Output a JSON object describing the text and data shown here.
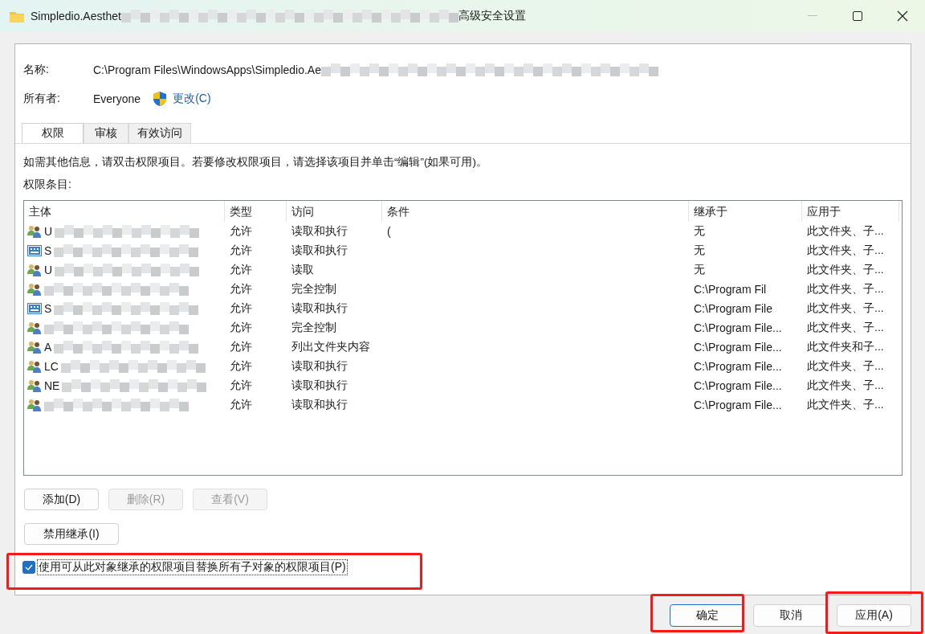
{
  "window": {
    "title_start": "Simpledio.Aesthet",
    "title_end": "高级安全设置"
  },
  "name": {
    "label": "名称:",
    "value": "C:\\Program Files\\WindowsApps\\Simpledio.Ae"
  },
  "owner": {
    "label": "所有者:",
    "value": "Everyone",
    "change_link": "更改(C)"
  },
  "tabs": [
    {
      "label": "权限",
      "selected": true
    },
    {
      "label": "审核",
      "selected": false
    },
    {
      "label": "有效访问",
      "selected": false
    }
  ],
  "info": "如需其他信息，请双击权限项目。若要修改权限项目，请选择该项目并单击“编辑”(如果可用)。",
  "entries_label": "权限条目:",
  "table": {
    "columns": [
      "主体",
      "类型",
      "访问",
      "条件",
      "继承于",
      "应用于"
    ],
    "rows": [
      {
        "kind": "group",
        "principal": "U",
        "redacted": true,
        "type": "允许",
        "access": "读取和执行",
        "condition": "(",
        "inherited_from": "无",
        "applies_to": "此文件夹、子..."
      },
      {
        "kind": "sid",
        "principal": "S",
        "redacted": true,
        "type": "允许",
        "access": "读取和执行",
        "condition": "",
        "inherited_from": "无",
        "applies_to": "此文件夹、子..."
      },
      {
        "kind": "group",
        "principal": "U",
        "redacted": true,
        "type": "允许",
        "access": "读取",
        "condition": "",
        "inherited_from": "无",
        "applies_to": "此文件夹、子..."
      },
      {
        "kind": "group",
        "principal": "",
        "redacted": true,
        "type": "允许",
        "access": "完全控制",
        "condition": "",
        "inherited_from": "C:\\Program Fil",
        "applies_to": "此文件夹、子..."
      },
      {
        "kind": "sid",
        "principal": "S",
        "redacted": true,
        "type": "允许",
        "access": "读取和执行",
        "condition": "",
        "inherited_from": "C:\\Program File",
        "applies_to": "此文件夹、子..."
      },
      {
        "kind": "group",
        "principal": "",
        "redacted": true,
        "type": "允许",
        "access": "完全控制",
        "condition": "",
        "inherited_from": "C:\\Program File...",
        "applies_to": "此文件夹、子..."
      },
      {
        "kind": "group",
        "principal": "A",
        "redacted": true,
        "type": "允许",
        "access": "列出文件夹内容",
        "condition": "",
        "inherited_from": "C:\\Program File...",
        "applies_to": "此文件夹和子..."
      },
      {
        "kind": "group",
        "principal": "LC",
        "redacted": true,
        "type": "允许",
        "access": "读取和执行",
        "condition": "",
        "inherited_from": "C:\\Program File...",
        "applies_to": "此文件夹、子..."
      },
      {
        "kind": "group",
        "principal": "NE",
        "redacted": true,
        "type": "允许",
        "access": "读取和执行",
        "condition": "",
        "inherited_from": "C:\\Program File...",
        "applies_to": "此文件夹、子..."
      },
      {
        "kind": "group",
        "principal": "",
        "redacted": true,
        "type": "允许",
        "access": "读取和执行",
        "condition": "",
        "inherited_from": "C:\\Program File...",
        "applies_to": "此文件夹、子..."
      }
    ]
  },
  "entry_buttons": [
    {
      "label": "添加(D)",
      "disabled": false
    },
    {
      "label": "删除(R)",
      "disabled": true
    },
    {
      "label": "查看(V)",
      "disabled": true
    }
  ],
  "disable_inheritance": "禁用继承(I)",
  "replace_checkbox": {
    "label": "使用可从此对象继承的权限项目替换所有子对象的权限项目(P)",
    "checked": true
  },
  "dialog_buttons": [
    {
      "label": "确定",
      "default": true
    },
    {
      "label": "取消",
      "default": false
    },
    {
      "label": "应用(A)",
      "default": false
    }
  ]
}
